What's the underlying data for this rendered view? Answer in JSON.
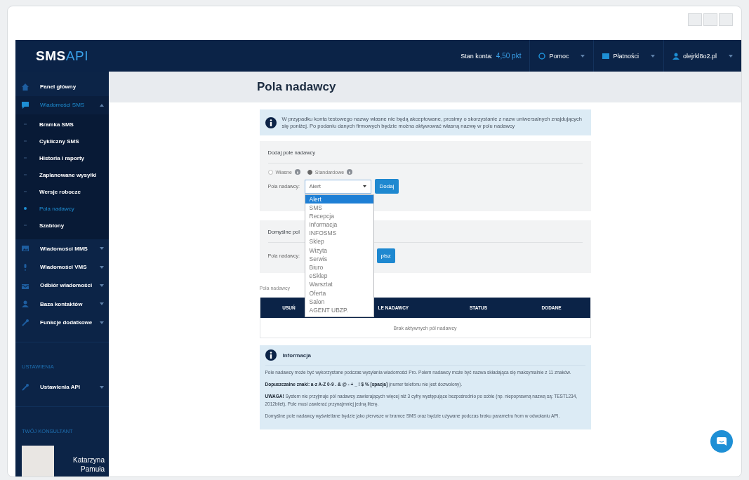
{
  "brand": {
    "left": "SMS",
    "right": "API"
  },
  "top_nav": {
    "balance_label": "Stan konta:",
    "balance_value": "4,50 pkt",
    "items": [
      {
        "label": "Pomoc"
      },
      {
        "label": "Płatności"
      },
      {
        "label": "olejrkl8o2.pl"
      }
    ]
  },
  "sidebar": {
    "items": [
      {
        "kind": "item",
        "label": "Panel główny",
        "selected": false
      },
      {
        "kind": "item",
        "label": "Wiadomości SMS",
        "selected": true,
        "expanded": true,
        "children": [
          {
            "label": "Bramka SMS",
            "selected": false
          },
          {
            "label": "Cykliczny SMS",
            "selected": false
          },
          {
            "label": "Historia i raporty",
            "selected": false
          },
          {
            "label": "Zaplanowane wysyłki",
            "selected": false
          },
          {
            "label": "Wersje robocze",
            "selected": false
          },
          {
            "label": "Pola nadawcy",
            "selected": true
          },
          {
            "label": "Szablony",
            "selected": false
          }
        ]
      },
      {
        "kind": "item",
        "label": "Wiadomości MMS",
        "selected": false,
        "expanded": false
      },
      {
        "kind": "item",
        "label": "Wiadomości VMS",
        "selected": false,
        "expanded": false
      },
      {
        "kind": "item",
        "label": "Odbiór wiadomości",
        "selected": false,
        "expanded": false
      },
      {
        "kind": "item",
        "label": "Baza kontaktów",
        "selected": false,
        "expanded": false
      },
      {
        "kind": "item",
        "label": "Funkcje dodatkowe",
        "selected": false,
        "expanded": false
      },
      {
        "kind": "section",
        "label": "USTAWIENIA"
      },
      {
        "kind": "item",
        "label": "Ustawienia API",
        "selected": false,
        "expanded": false
      },
      {
        "kind": "section",
        "label": "TWÓJ KONSULTANT"
      },
      {
        "kind": "consultant",
        "label": "Katarzyna",
        "sublabel": "Pamuła"
      }
    ]
  },
  "page": {
    "title": "Pola nadawcy"
  },
  "notice": {
    "text": "W przypadku konta testowego nazwy własne nie będą akceptowane, prosimy o skorzystanie z nazw uniwersalnych znajdujących się poniżej. Po podaniu danych firmowych będzie można aktywować własną nazwę w polu nadawcy"
  },
  "add_card": {
    "title": "Dodaj pole nadawcy",
    "radios": [
      {
        "label": "Własne",
        "selected": false
      },
      {
        "label": "Standardowe",
        "selected": true
      }
    ],
    "field_label": "Pola nadawcy:",
    "select_value": "Alert",
    "button": "Dodaj",
    "dropdown_open": true,
    "options": [
      {
        "label": "Alert",
        "selected": true
      },
      {
        "label": "SMS",
        "selected": false
      },
      {
        "label": "Recepcja",
        "selected": false
      },
      {
        "label": "Informacja",
        "selected": false
      },
      {
        "label": "INFOSMS",
        "selected": false
      },
      {
        "label": "Sklep",
        "selected": false
      },
      {
        "label": "Wizyta",
        "selected": false
      },
      {
        "label": "Serwis",
        "selected": false
      },
      {
        "label": "Biuro",
        "selected": false
      },
      {
        "label": "eSklep",
        "selected": false
      },
      {
        "label": "Warsztat",
        "selected": false
      },
      {
        "label": "Oferta",
        "selected": false
      },
      {
        "label": "Salon",
        "selected": false
      },
      {
        "label": "AGENT UBZP.",
        "selected": false
      }
    ]
  },
  "default_card": {
    "title": "Domyślne pol",
    "field_label": "Pola nadawcy:",
    "button": "pisz"
  },
  "table": {
    "label": "Pola nadawcy",
    "columns": [
      "USUŃ",
      "LE NADAWCY",
      "STATUS",
      "DODANE"
    ],
    "empty": "Brak aktywnych pól nadawcy"
  },
  "info": {
    "title": "Informacja",
    "paragraphs": [
      "Pole nadawcy może być wykorzystane podczas wysyłania wiadomości Pro. Polem nadawcy może być nazwa składająca się maksymalnie z 11 znaków.",
      "**Dopuszczalne znaki: a-z A-Z 0-9 . & @ - + _ ! $ % [spacja]** (numer telefonu nie jest dozwolony).",
      "**UWAGA!** System nie przyjmuje pól nadawcy zawierających więcej niż 3 cyfry występujące bezpośrednio po sobie (np. niepoprawną nazwą są: TEST1234, 2012bilet). Pole musi zawierać przynajmniej jedną literę.",
      "Domyślne pole nadawcy wyświetlane będzie jako pierwsze w bramce SMS oraz będzie używane podczas braku parametru from w odwołaniu API."
    ]
  }
}
